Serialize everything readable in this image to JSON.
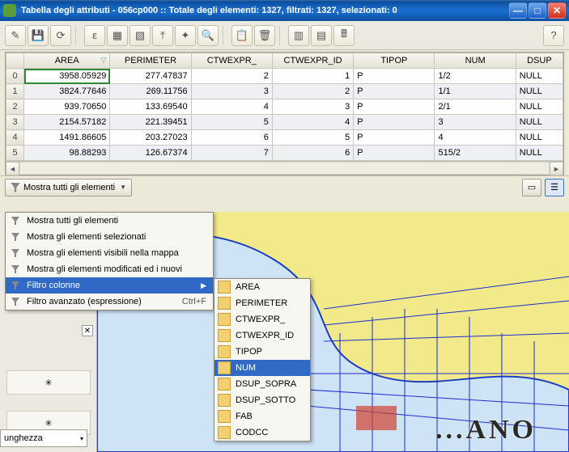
{
  "title": "Tabella degli attributi - 056cp000 :: Totale degli elementi: 1327, filtrati: 1327, selezionati: 0",
  "toolbar_icons": [
    "pencil",
    "save",
    "reload",
    "eps",
    "select-eps",
    "deselect",
    "move-top",
    "target",
    "invert",
    "pan-select",
    "clipboard",
    "delete",
    "calc",
    "table-new",
    "table-del"
  ],
  "columns": [
    "AREA",
    "PERIMETER",
    "CTWEXPR_",
    "CTWEXPR_ID",
    "TIPOP",
    "NUM",
    "DSUP"
  ],
  "rows": [
    {
      "idx": "0",
      "AREA": "3958.05929",
      "PERIMETER": "277.47837",
      "CTWEXPR_": "2",
      "CTWEXPR_ID": "1",
      "TIPOP": "P",
      "NUM": "1/2",
      "DSUP": "NULL"
    },
    {
      "idx": "1",
      "AREA": "3824.77646",
      "PERIMETER": "269.11756",
      "CTWEXPR_": "3",
      "CTWEXPR_ID": "2",
      "TIPOP": "P",
      "NUM": "1/1",
      "DSUP": "NULL"
    },
    {
      "idx": "2",
      "AREA": "939.70650",
      "PERIMETER": "133.69540",
      "CTWEXPR_": "4",
      "CTWEXPR_ID": "3",
      "TIPOP": "P",
      "NUM": "2/1",
      "DSUP": "NULL"
    },
    {
      "idx": "3",
      "AREA": "2154.57182",
      "PERIMETER": "221.39451",
      "CTWEXPR_": "5",
      "CTWEXPR_ID": "4",
      "TIPOP": "P",
      "NUM": "3",
      "DSUP": "NULL"
    },
    {
      "idx": "4",
      "AREA": "1491.86605",
      "PERIMETER": "203.27023",
      "CTWEXPR_": "6",
      "CTWEXPR_ID": "5",
      "TIPOP": "P",
      "NUM": "4",
      "DSUP": "NULL"
    },
    {
      "idx": "5",
      "AREA": "98.88293",
      "PERIMETER": "126.67374",
      "CTWEXPR_": "7",
      "CTWEXPR_ID": "6",
      "TIPOP": "P",
      "NUM": "515/2",
      "DSUP": "NULL"
    }
  ],
  "filter_button_label": "Mostra tutti gli elementi",
  "context_menu": [
    {
      "label": "Mostra tutti gli elementi"
    },
    {
      "label": "Mostra gli elementi selezionati"
    },
    {
      "label": "Mostra gli elementi visibili nella mappa"
    },
    {
      "label": "Mostra gli elementi modificati ed i nuovi"
    },
    {
      "label": "Filtro colonne",
      "submenu": true,
      "hi": true
    },
    {
      "label": "Filtro avanzato (espressione)",
      "shortcut": "Ctrl+F"
    }
  ],
  "submenu_items": [
    "AREA",
    "PERIMETER",
    "CTWEXPR_",
    "CTWEXPR_ID",
    "TIPOP",
    "NUM",
    "DSUP_SOPRA",
    "DSUP_SOTTO",
    "FAB",
    "CODCC"
  ],
  "submenu_hi": "NUM",
  "leftdock": {
    "label": "unghezza"
  },
  "map_label": "...ANO",
  "help_icon": "?"
}
